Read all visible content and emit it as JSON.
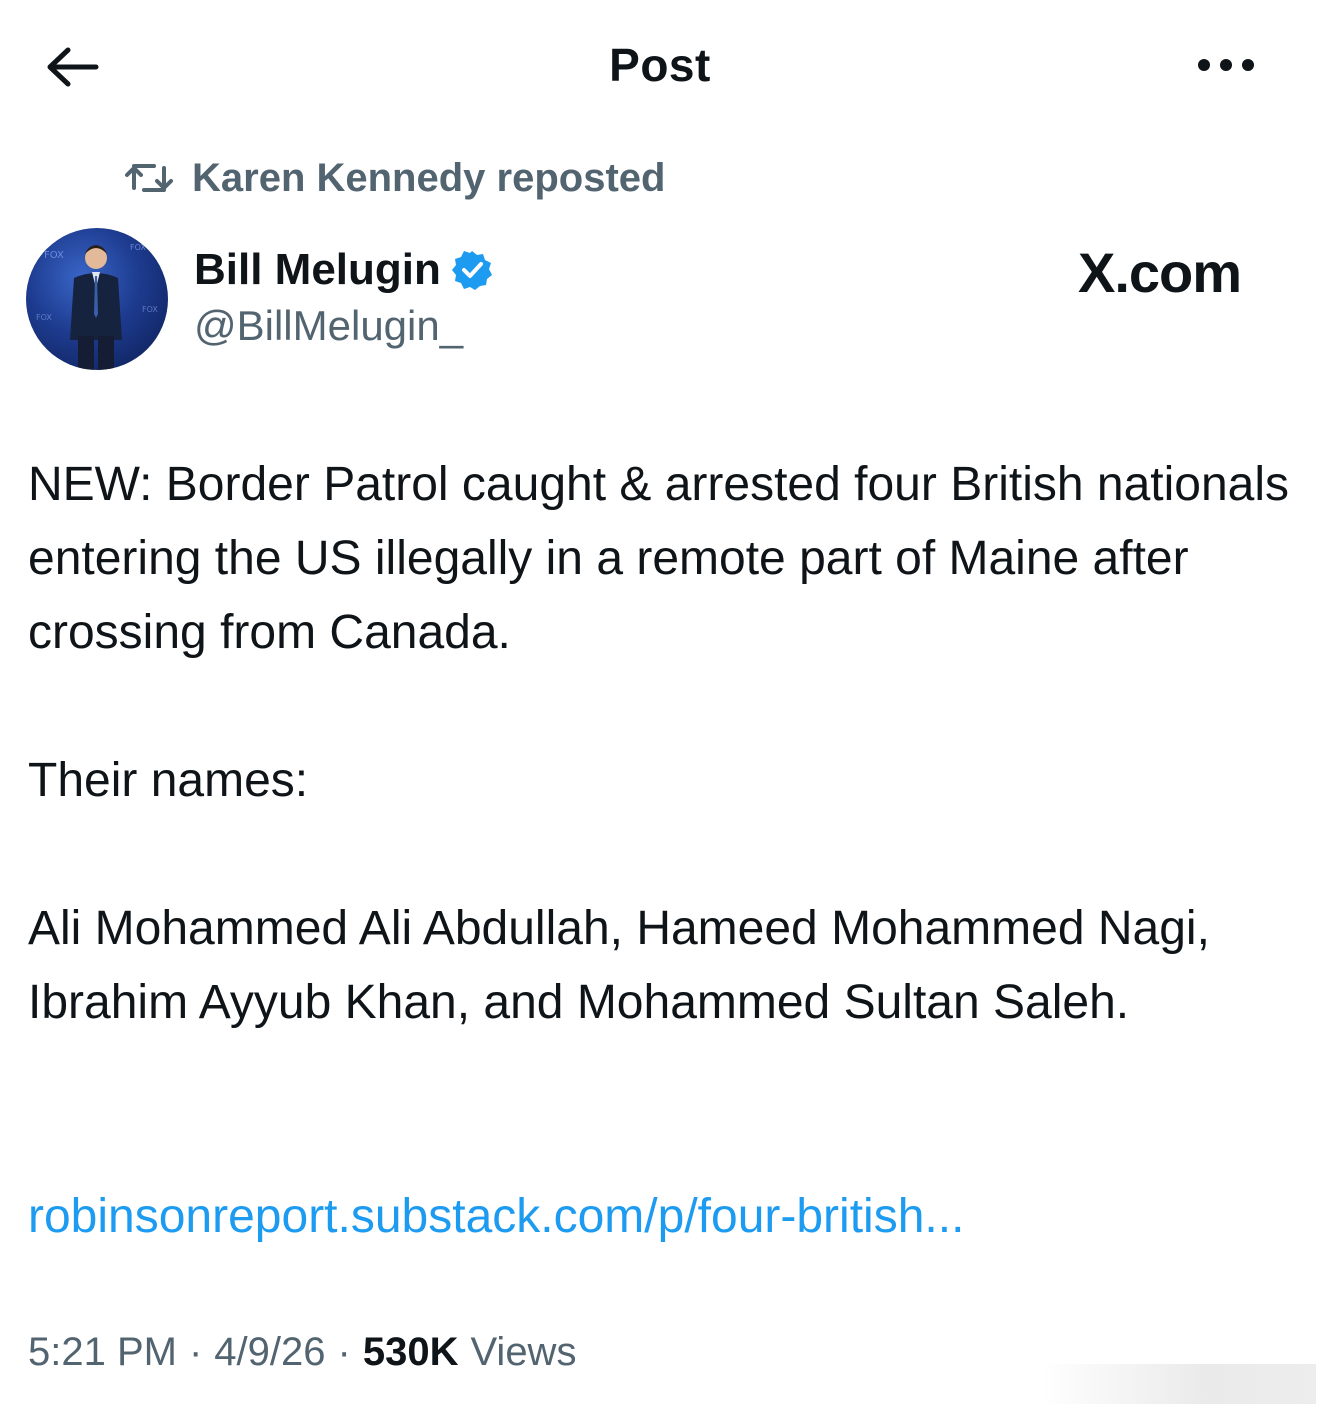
{
  "header": {
    "title": "Post",
    "back_icon": "arrow-left-icon",
    "more_icon": "more-horizontal-icon"
  },
  "repost": {
    "icon": "repost-icon",
    "text": "Karen Kennedy reposted"
  },
  "author": {
    "name": "Bill Melugin",
    "handle": "@BillMelugin_",
    "verified_icon": "verified-badge-icon",
    "verified_color": "#1d9bf0"
  },
  "watermark": "X.com",
  "post": {
    "paragraphs": [
      "NEW: Border Patrol caught & arrested four British nationals entering the US illegally in a remote part of Maine after crossing from Canada.",
      "Their names:",
      "Ali Mohammed Ali Abdullah, Hameed Mohammed Nagi, Ibrahim Ayyub Khan, and Mohammed Sultan Saleh."
    ],
    "link_text": "robinsonreport.substack.com/p/four-british..."
  },
  "meta": {
    "time": "5:21 PM",
    "separator": "·",
    "date": "4/9/26",
    "views_count": "530K",
    "views_label": "Views"
  },
  "colors": {
    "text": "#0f1419",
    "secondary": "#536471",
    "link": "#1d9bf0"
  }
}
